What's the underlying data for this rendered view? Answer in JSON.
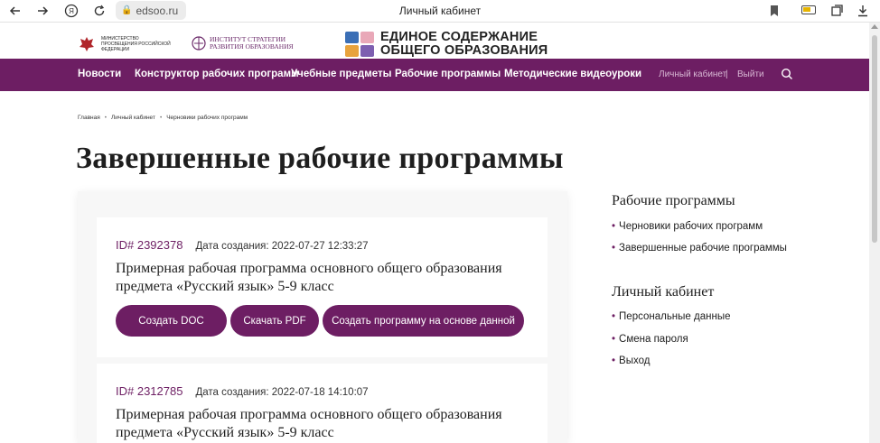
{
  "browser": {
    "url": "edsoo.ru",
    "tab_title": "Личный кабинет"
  },
  "header": {
    "logo_ministry": "Министерство просвещения Российской Федерации",
    "logo_institute_line1": "Институт стратегии",
    "logo_institute_line2": "развития образования",
    "logo_main_line1": "ЕДИНОЕ СОДЕРЖАНИЕ",
    "logo_main_line2": "ОБЩЕГО ОБРАЗОВАНИЯ",
    "tile_colors": [
      "#3b6fb6",
      "#e9a8b8",
      "#e8a33d",
      "#7d5fb0"
    ]
  },
  "nav": {
    "items": [
      "Новости",
      "Конструктор рабочих программ",
      "Учебные предметы",
      "Рабочие программы",
      "Методические видеоуроки"
    ],
    "account": "Личный кабинет",
    "separator": "|",
    "logout": "Выйти"
  },
  "breadcrumb": [
    "Главная",
    "Личный кабинет",
    "Черновики рабочих программ"
  ],
  "page_title": "Завершенные рабочие программы",
  "programs": [
    {
      "id": "ID# 2392378",
      "date": "Дата создания: 2022-07-27 12:33:27",
      "title": "Примерная рабочая программа основного общего образования предмета «Русский язык» 5-9 класс",
      "buttons": [
        "Создать DOC",
        "Скачать PDF",
        "Создать программу на основе данной"
      ]
    },
    {
      "id": "ID# 2312785",
      "date": "Дата создания: 2022-07-18 14:10:07",
      "title": "Примерная рабочая программа основного общего образования предмета «Русский язык» 5-9 класс"
    }
  ],
  "sidebar": {
    "section1_title": "Рабочие программы",
    "section1_items": [
      "Черновики рабочих программ",
      "Завершенные рабочие программы"
    ],
    "section2_title": "Личный кабинет",
    "section2_items": [
      "Персональные данные",
      "Смена пароля",
      "Выход"
    ],
    "bullet": "•"
  },
  "colors": {
    "brand": "#6d1e63",
    "nav_text": "#ffffff",
    "accent_text": "#6d1e63"
  }
}
